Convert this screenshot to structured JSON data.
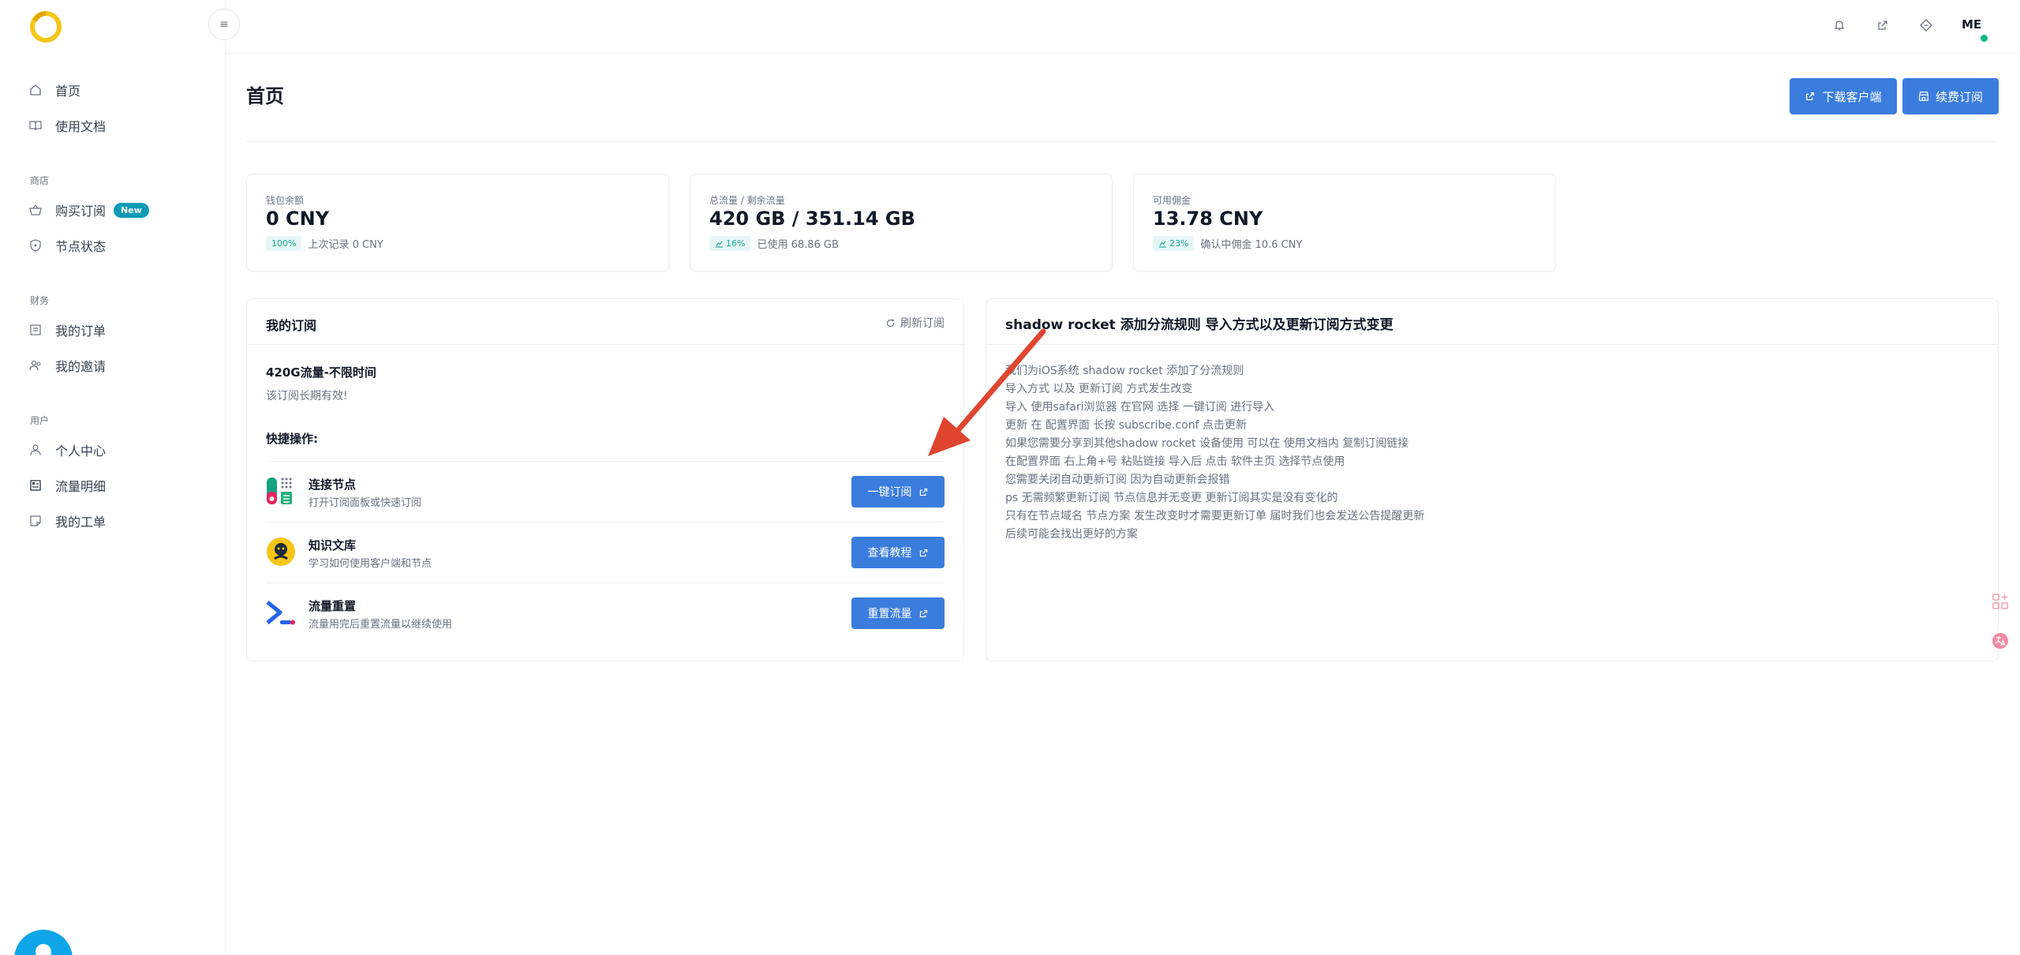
{
  "sidebar": {
    "items_top": [
      {
        "label": "首页",
        "icon": "home-icon"
      },
      {
        "label": "使用文档",
        "icon": "book-icon"
      }
    ],
    "section_shop": "商店",
    "items_shop": [
      {
        "label": "购买订阅",
        "icon": "basket-icon",
        "badge": "New"
      },
      {
        "label": "节点状态",
        "icon": "shield-icon"
      }
    ],
    "section_finance": "财务",
    "items_finance": [
      {
        "label": "我的订单",
        "icon": "receipt-icon"
      },
      {
        "label": "我的邀请",
        "icon": "users-icon"
      }
    ],
    "section_user": "用户",
    "items_user": [
      {
        "label": "个人中心",
        "icon": "user-icon"
      },
      {
        "label": "流量明细",
        "icon": "calendar-icon"
      },
      {
        "label": "我的工单",
        "icon": "ticket-icon"
      }
    ]
  },
  "header": {
    "toggle_icon": "≡",
    "avatar": "ME"
  },
  "page": {
    "title": "首页",
    "download_label": "下载客户端",
    "renew_label": "续费订阅"
  },
  "stats": [
    {
      "label": "钱包余额",
      "value": "0 CNY",
      "chip": "100%",
      "sub": "上次记录 0 CNY"
    },
    {
      "label": "总流量 / 剩余流量",
      "value": "420 GB / 351.14 GB",
      "chip": "16%",
      "sub": "已使用 68.86 GB"
    },
    {
      "label": "可用佣金",
      "value": "13.78 CNY",
      "chip": "23%",
      "sub": "确认中佣金 10.6 CNY"
    }
  ],
  "subscription": {
    "title": "我的订阅",
    "refresh_label": "刷新订阅",
    "plan_name": "420G流量-不限时间",
    "plan_desc": "该订阅长期有效!",
    "quick_title": "快捷操作:",
    "quick": [
      {
        "name": "连接节点",
        "desc": "打开订阅面板或快速订阅",
        "button": "一键订阅"
      },
      {
        "name": "知识文库",
        "desc": "学习如何使用客户端和节点",
        "button": "查看教程"
      },
      {
        "name": "流量重置",
        "desc": "流量用完后重置流量以继续使用",
        "button": "重置流量"
      }
    ]
  },
  "notice": {
    "title": "shadow rocket 添加分流规则 导入方式以及更新订阅方式变更",
    "lines": [
      "我们为iOS系统 shadow rocket 添加了分流规则",
      "导入方式 以及 更新订阅 方式发生改变",
      "导入 使用safari浏览器 在官网 选择 一键订阅 进行导入",
      "更新 在 配置界面 长按 subscribe.conf 点击更新",
      "如果您需要分享到其他shadow rocket 设备使用 可以在 使用文档内 复制订阅链接",
      "在配置界面 右上角+号 粘贴链接 导入后 点击 软件主页 选择节点使用",
      "您需要关闭自动更新订阅 因为自动更新会报错",
      "ps 无需频繁更新订阅 节点信息并无变更 更新订阅其实是没有变化的",
      "只有在节点域名 节点方案 发生改变时才需要更新订单 届时我们也会发送公告提醒更新",
      "后续可能会找出更好的方案"
    ]
  },
  "colors": {
    "primary": "#3b7ddd",
    "accent_teal": "#1aa89c",
    "badge": "#0e9bb5",
    "arrow": "#e0452f"
  }
}
